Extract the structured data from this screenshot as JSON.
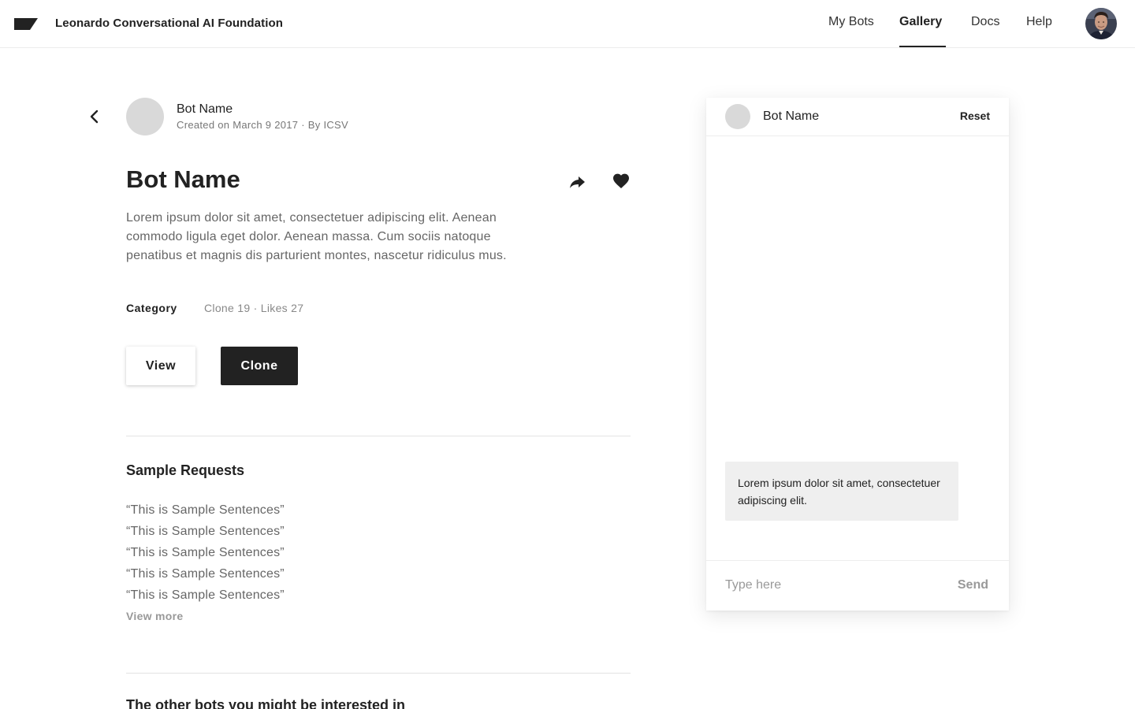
{
  "header": {
    "brand": "Leonardo Conversational AI Foundation",
    "nav": [
      {
        "label": "My Bots",
        "active": false
      },
      {
        "label": "Gallery",
        "active": true
      },
      {
        "label": "Docs",
        "active": false
      },
      {
        "label": "Help",
        "active": false
      }
    ]
  },
  "bot": {
    "name_small": "Bot Name",
    "created": "Created on March 9 2017 · By ICSV",
    "title": "Bot Name",
    "description": "Lorem ipsum dolor sit amet, consectetuer adipiscing elit. Aenean commodo ligula eget dolor. Aenean massa. Cum sociis natoque penatibus et magnis dis parturient montes, nascetur ridiculus mus.",
    "category_label": "Category",
    "stats": "Clone 19 · Likes 27"
  },
  "actions": {
    "view_label": "View",
    "clone_label": "Clone"
  },
  "samples": {
    "title": "Sample Requests",
    "items": [
      "“This is Sample Sentences”",
      "“This is Sample Sentences”",
      "“This is Sample Sentences”",
      "“This is Sample Sentences”",
      "“This is Sample Sentences”"
    ],
    "view_more": "View more"
  },
  "other_bots": {
    "title": "The other bots you might be interested in"
  },
  "chat": {
    "bot_name": "Bot Name",
    "reset_label": "Reset",
    "message": "Lorem ipsum dolor sit amet, consectetuer adipiscing elit.",
    "input_placeholder": "Type here",
    "send_label": "Send"
  },
  "icons": {
    "logo": "logo-icon",
    "back": "chevron-left-icon",
    "share": "share-icon",
    "like": "heart-icon"
  },
  "colors": {
    "primary": "#222222",
    "muted": "#999999",
    "bubble": "#efefef",
    "avatar_placeholder": "#d9d9d9"
  }
}
